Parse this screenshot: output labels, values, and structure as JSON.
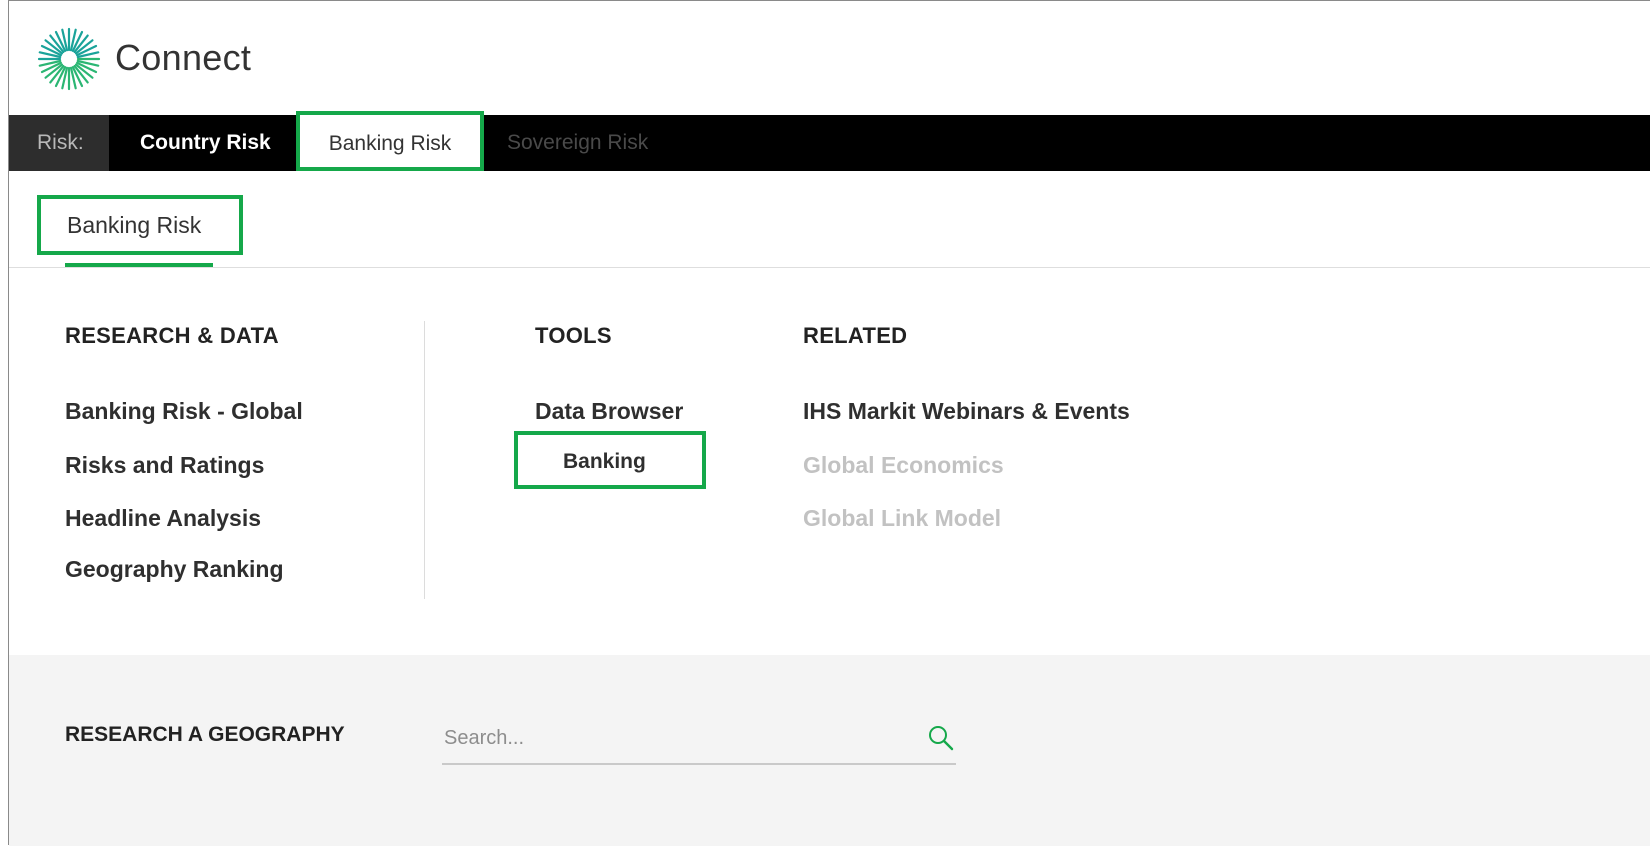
{
  "app": {
    "title": "Connect"
  },
  "topnav": {
    "prefix": "Risk:",
    "items": [
      {
        "label": "Country Risk"
      },
      {
        "label": "Banking Risk"
      },
      {
        "label": "Sovereign Risk"
      }
    ]
  },
  "subnav": {
    "label": "Banking Risk"
  },
  "menu": {
    "research": {
      "heading": "RESEARCH & DATA",
      "links": [
        "Banking Risk - Global",
        "Risks and Ratings",
        "Headline Analysis",
        "Geography Ranking"
      ]
    },
    "tools": {
      "heading": "TOOLS",
      "links": [
        "Data Browser",
        "Banking"
      ]
    },
    "related": {
      "heading": "RELATED",
      "links": [
        "IHS Markit Webinars & Events",
        "Global Economics",
        "Global Link Model"
      ]
    }
  },
  "search": {
    "label": "RESEARCH A GEOGRAPHY",
    "placeholder": "Search..."
  },
  "colors": {
    "accent": "#15a84a",
    "nav_bg": "#000000",
    "band_bg": "#f4f4f4"
  },
  "icons": {
    "logo": "sunburst-logo-icon",
    "search": "search-icon"
  }
}
